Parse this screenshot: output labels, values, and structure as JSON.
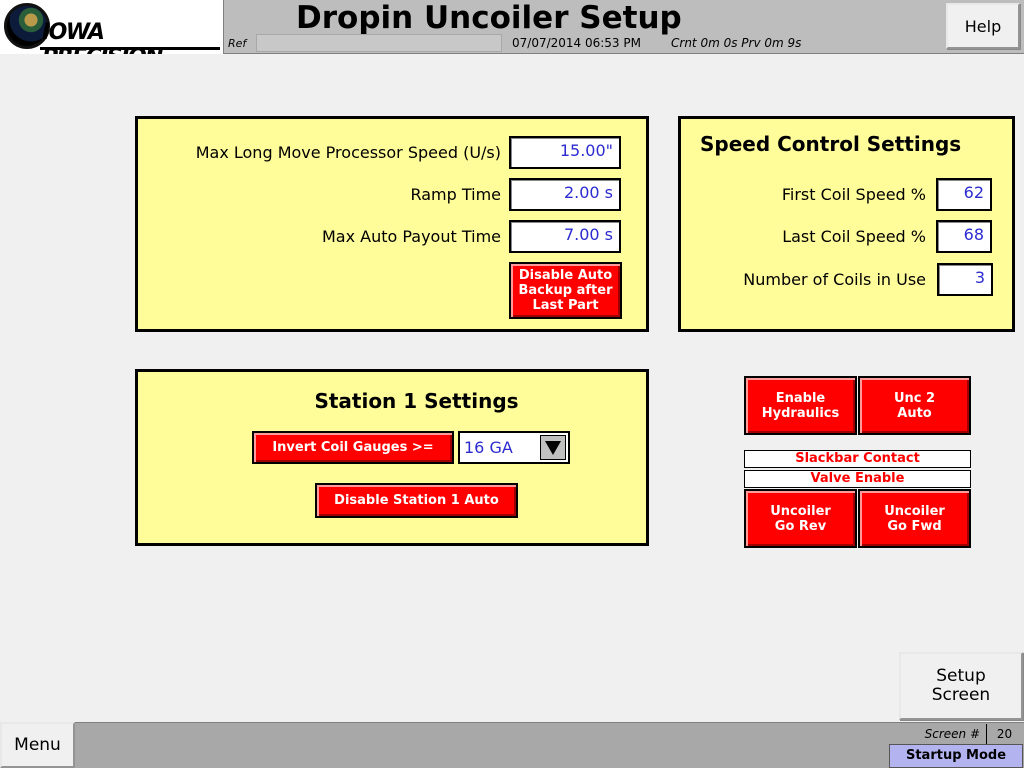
{
  "header": {
    "logo_text": "IOWA PRECISION",
    "title": "Dropin Uncoiler Setup",
    "ref_label": "Ref",
    "ref_value": "",
    "datetime": "07/07/2014 06:53 PM",
    "timers": "Crnt  0m  0s  Prv  0m  9s",
    "help_label": "Help"
  },
  "processor_panel": {
    "max_long_move_label": "Max Long Move Processor Speed (U/s)",
    "max_long_move_value": "15.00\"",
    "ramp_time_label": "Ramp Time",
    "ramp_time_value": "2.00  s",
    "max_auto_payout_label": "Max Auto Payout Time",
    "max_auto_payout_value": "7.00  s",
    "disable_auto_backup_label": "Disable Auto Backup after Last Part"
  },
  "speed_panel": {
    "heading": "Speed Control Settings",
    "first_coil_label": "First Coil Speed %",
    "first_coil_value": "62",
    "last_coil_label": "Last Coil Speed %",
    "last_coil_value": "68",
    "num_coils_label": "Number of Coils in Use",
    "num_coils_value": "3"
  },
  "station_panel": {
    "heading": "Station 1 Settings",
    "invert_gauges_label": "Invert Coil Gauges >=",
    "gauge_selected": "16 GA",
    "disable_station_label": "Disable Station 1 Auto"
  },
  "controls": {
    "enable_hydraulics_label": "Enable Hydraulics",
    "unc2_auto_label": "Unc 2 Auto",
    "slackbar_contact": "Slackbar Contact",
    "valve_enable": "Valve Enable",
    "go_rev_label": "Uncoiler Go Rev",
    "go_fwd_label": "Uncoiler Go Fwd"
  },
  "setup_screen_label": "Setup Screen",
  "footer": {
    "menu_label": "Menu",
    "screen_label": "Screen #",
    "screen_number": "20",
    "mode": "Startup Mode"
  },
  "colors": {
    "panel_bg": "#fffc9a",
    "button_red": "#ff0000",
    "value_blue": "#2b2bd0",
    "mode_bg": "#b3b3f0"
  }
}
